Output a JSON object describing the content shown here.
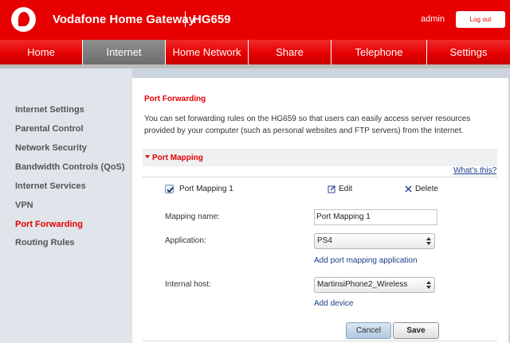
{
  "header": {
    "brand": "Vodafone Home Gateway",
    "model": "HG659",
    "user": "admin",
    "logout_label": "Log out"
  },
  "nav": {
    "items": [
      {
        "label": "Home"
      },
      {
        "label": "Internet"
      },
      {
        "label": "Home Network"
      },
      {
        "label": "Share"
      },
      {
        "label": "Telephone"
      },
      {
        "label": "Settings"
      }
    ],
    "active": "Internet"
  },
  "sidebar": {
    "items": [
      {
        "label": "Internet Settings"
      },
      {
        "label": "Parental Control"
      },
      {
        "label": "Network Security"
      },
      {
        "label": "Bandwidth Controls (QoS)"
      },
      {
        "label": "Internet Services"
      },
      {
        "label": "VPN"
      },
      {
        "label": "Port Forwarding"
      },
      {
        "label": "Routing Rules"
      }
    ],
    "active": "Port Forwarding"
  },
  "main": {
    "title": "Port Forwarding",
    "description": "You can set forwarding rules on the HG659 so that users can easily access server resources provided by your computer (such as personal websites and FTP servers) from the Internet.",
    "section_title": "Port Mapping",
    "whats_this": "What's this?",
    "rule": {
      "checked": true,
      "label": "Port Mapping 1",
      "edit_label": "Edit",
      "delete_label": "Delete"
    },
    "form": {
      "mapping_name_label": "Mapping name:",
      "mapping_name_value": "Port Mapping 1",
      "application_label": "Application:",
      "application_value": "PS4",
      "add_application_link": "Add port mapping application",
      "internal_host_label": "Internal host:",
      "internal_host_value": "MartinsiPhone2_Wireless",
      "add_device_link": "Add device"
    },
    "buttons": {
      "cancel": "Cancel",
      "save": "Save"
    }
  },
  "colors": {
    "brand_red": "#e60000",
    "link_blue": "#1a3e8a",
    "sidebar_bg": "#dfe5ea"
  }
}
